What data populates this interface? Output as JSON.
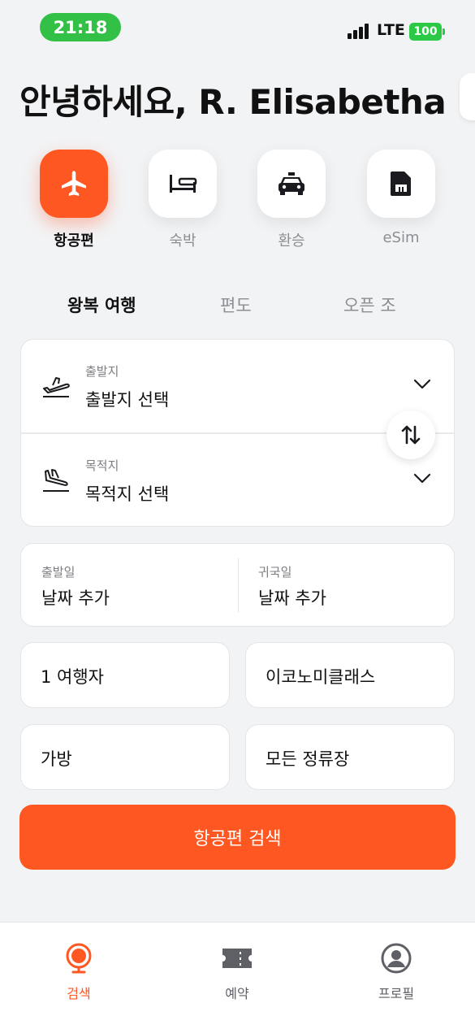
{
  "status_bar": {
    "time": "21:18",
    "network": "LTE",
    "battery": "100"
  },
  "greeting": "안녕하세요, R. Elisabetha",
  "categories": [
    {
      "label": "항공편",
      "icon": "airplane-icon",
      "active": true
    },
    {
      "label": "숙박",
      "icon": "bed-icon",
      "active": false
    },
    {
      "label": "환승",
      "icon": "taxi-icon",
      "active": false
    },
    {
      "label": "eSim",
      "icon": "sim-card-icon",
      "active": false
    }
  ],
  "trip_tabs": [
    {
      "label": "왕복 여행",
      "active": true
    },
    {
      "label": "편도",
      "active": false
    },
    {
      "label": "오픈 조",
      "active": false
    }
  ],
  "route": {
    "origin": {
      "label": "출발지",
      "value": "출발지 선택"
    },
    "destination": {
      "label": "목적지",
      "value": "목적지 선택"
    }
  },
  "dates": {
    "departure": {
      "label": "출발일",
      "value": "날짜 추가"
    },
    "return": {
      "label": "귀국일",
      "value": "날짜 추가"
    }
  },
  "options": {
    "travelers": "1 여행자",
    "cabin_class": "이코노미클래스",
    "baggage": "가방",
    "stops": "모든 정류장"
  },
  "search_button": "항공편 검색",
  "bottom_nav": [
    {
      "label": "검색",
      "icon": "globe-search-icon",
      "active": true
    },
    {
      "label": "예약",
      "icon": "ticket-icon",
      "active": false
    },
    {
      "label": "프로필",
      "icon": "profile-icon",
      "active": false
    }
  ],
  "colors": {
    "accent": "#ff5722",
    "status_green": "#33c047",
    "background": "#f2f3f5"
  }
}
